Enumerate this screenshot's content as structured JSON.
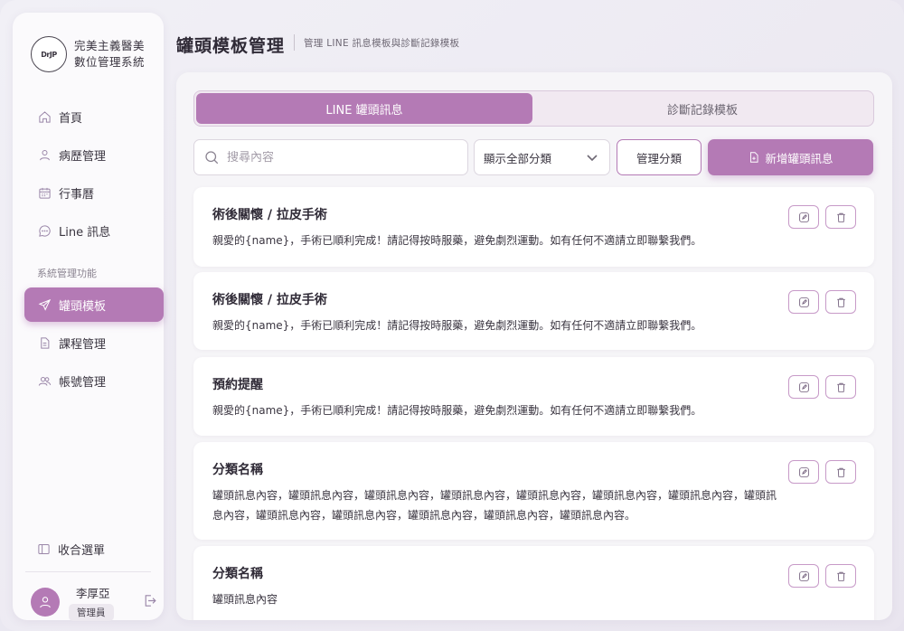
{
  "brand": {
    "logo_text": "DrJP",
    "name_line1": "完美主義醫美",
    "name_line2": "數位管理系統"
  },
  "sidebar": {
    "items": [
      {
        "label": "首頁",
        "icon": "home-icon"
      },
      {
        "label": "病歷管理",
        "icon": "user-icon"
      },
      {
        "label": "行事曆",
        "icon": "calendar-icon"
      },
      {
        "label": "Line 訊息",
        "icon": "chat-icon"
      }
    ],
    "section_label": "系統管理功能",
    "admin_items": [
      {
        "label": "罐頭模板",
        "icon": "send-icon",
        "active": true
      },
      {
        "label": "課程管理",
        "icon": "document-icon"
      },
      {
        "label": "帳號管理",
        "icon": "users-icon"
      }
    ],
    "collapse_label": "收合選單"
  },
  "user": {
    "name": "李厚亞",
    "role": "管理員"
  },
  "header": {
    "title": "罐頭模板管理",
    "subtitle": "管理 LINE 訊息模板與診斷記錄模板"
  },
  "tabs": [
    {
      "label": "LINE 罐頭訊息",
      "active": true
    },
    {
      "label": "診斷記錄模板",
      "active": false
    }
  ],
  "toolbar": {
    "search_placeholder": "搜尋內容",
    "search_value": "",
    "filter_selected": "顯示全部分類",
    "manage_categories_label": "管理分類",
    "add_label": "新增罐頭訊息"
  },
  "templates": [
    {
      "title": "術後關懷 / 拉皮手術",
      "content": "親愛的{name}，手術已順利完成！請記得按時服藥，避免劇烈運動。如有任何不適請立即聯繫我們。"
    },
    {
      "title": "術後關懷 / 拉皮手術",
      "content": "親愛的{name}，手術已順利完成！請記得按時服藥，避免劇烈運動。如有任何不適請立即聯繫我們。"
    },
    {
      "title": "預約提醒",
      "content": "親愛的{name}，手術已順利完成！請記得按時服藥，避免劇烈運動。如有任何不適請立即聯繫我們。"
    },
    {
      "title": "分類名稱",
      "content": "罐頭訊息內容，罐頭訊息內容，罐頭訊息內容，罐頭訊息內容，罐頭訊息內容，罐頭訊息內容，罐頭訊息內容，罐頭訊息內容，罐頭訊息內容，罐頭訊息內容，罐頭訊息內容，罐頭訊息內容，罐頭訊息內容。"
    },
    {
      "title": "分類名稱",
      "content": "罐頭訊息內容"
    }
  ],
  "colors": {
    "accent": "#b47ab5",
    "background": "#ecebf3"
  }
}
